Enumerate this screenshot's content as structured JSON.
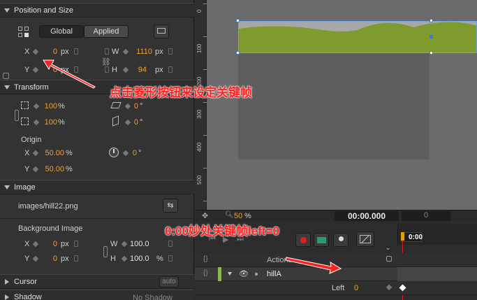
{
  "properties": {
    "position_size": {
      "title": "Position and Size",
      "global_label": "Global",
      "applied_label": "Applied",
      "x_label": "X",
      "x_value": "0",
      "x_unit": "px",
      "y_label": "Y",
      "y_value": "0",
      "y_unit": "px",
      "w_label": "W",
      "w_value": "1110",
      "w_unit": "px",
      "h_label": "H",
      "h_value": "94",
      "h_unit": "px"
    },
    "transform": {
      "title": "Transform",
      "scale_x": "100",
      "scale_y": "100",
      "pct": "%",
      "skew_x": "0",
      "skew_y": "0",
      "deg": "°",
      "origin_label": "Origin",
      "origin_x_label": "X",
      "origin_x": "50.00",
      "origin_y_label": "Y",
      "origin_y": "50.00",
      "rotation": "0"
    },
    "image": {
      "title": "Image",
      "path": "images/hill22.png",
      "bg_label": "Background Image",
      "x_label": "X",
      "x_value": "0",
      "x_unit": "px",
      "y_label": "Y",
      "y_value": "0",
      "y_unit": "px",
      "w_label": "W",
      "w_value": "100.0",
      "h_label": "H",
      "h_value": "100.0",
      "h_unit": "%"
    },
    "cursor": {
      "title": "Cursor",
      "auto_label": "auto"
    },
    "shadow": {
      "title": "Shadow",
      "value": "No Shadow"
    }
  },
  "stage": {
    "ruler_labels": [
      "0",
      "100",
      "200",
      "300",
      "400",
      "500"
    ],
    "zoom": "50",
    "zoom_unit": "%",
    "time": "00:00.000",
    "frame": "0"
  },
  "timeline": {
    "playhead_time": "0:00",
    "actions_label": "Actions",
    "element_name": "hillA",
    "property_label": "Left",
    "property_value": "0"
  },
  "annotations": {
    "keyframe_hint": "点击菱形按钮来设定关键帧",
    "left_hint": "0:00妙处关键帧left=0"
  },
  "colors": {
    "accent_orange": "#f0a030",
    "annotation_red": "#ff2020",
    "hill_green": "#7f9a2e",
    "element_bar": "#8bb84a"
  }
}
